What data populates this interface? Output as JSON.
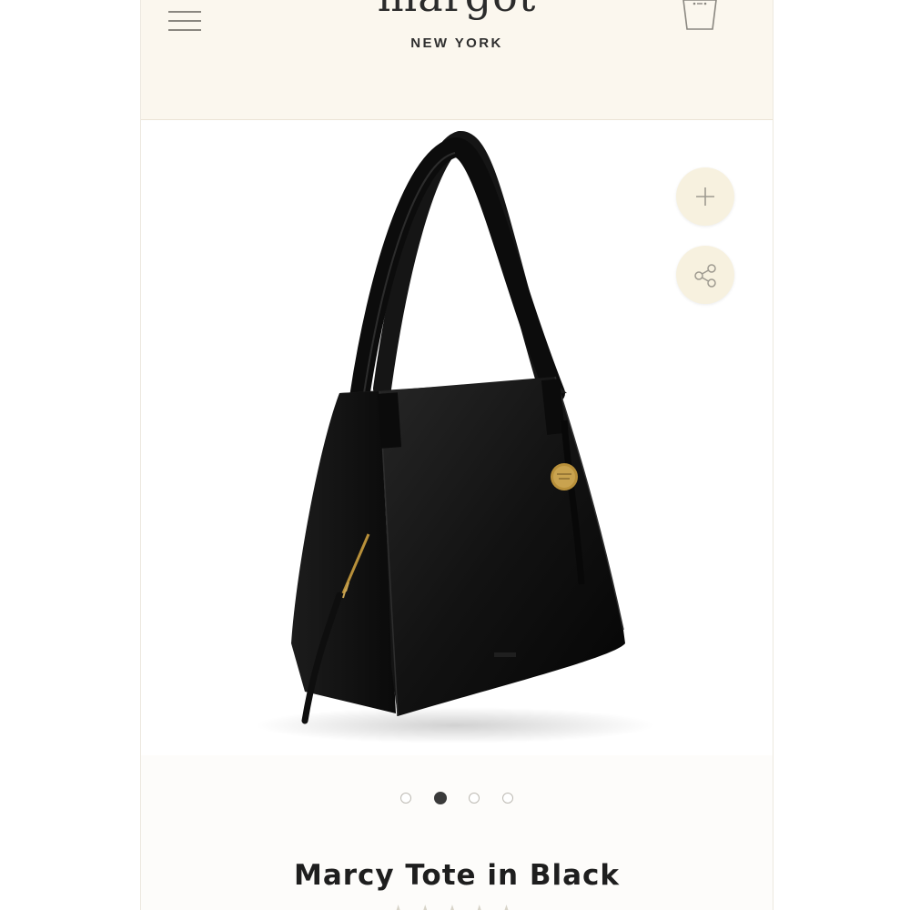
{
  "header": {
    "brand_name": "margot",
    "brand_location": "NEW YORK",
    "menu_icon": "hamburger-menu-icon",
    "bag_icon": "shopping-bag-icon"
  },
  "gallery": {
    "image_alt": "Marcy Tote in Black",
    "actions": [
      {
        "name": "add",
        "icon": "plus-icon"
      },
      {
        "name": "share",
        "icon": "share-icon"
      }
    ],
    "dots_count": 4,
    "active_dot": 2
  },
  "product": {
    "title": "Marcy Tote in Black",
    "rating_stars": "★★★★★"
  },
  "colors": {
    "header_bg": "#fbf7ee",
    "button_bg": "#f7f1df",
    "accent_gold": "#b8903a"
  }
}
